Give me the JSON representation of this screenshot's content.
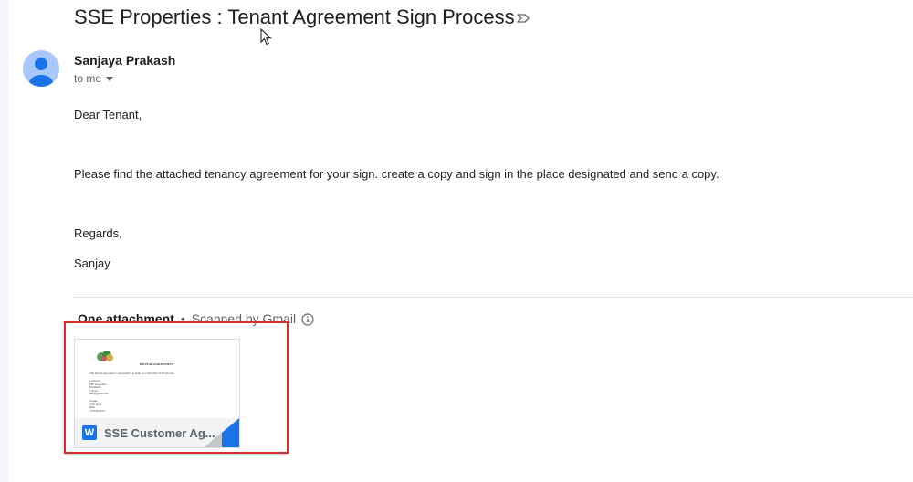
{
  "email": {
    "subject": "SSE Properties : Tenant Agreement Sign Process",
    "sender_name": "Sanjaya Prakash",
    "recipient_label": "to me",
    "body": {
      "greeting": "Dear Tenant,",
      "message": "Please find the attached tenancy agreement for your sign. create a copy and sign in the place designated and send a copy.",
      "closing": "Regards,",
      "signature": "Sanjay"
    }
  },
  "attachments": {
    "header_title": "One attachment",
    "separator": "•",
    "scanned_label": "Scanned by Gmail",
    "items": [
      {
        "file_name": "SSE Customer Ag...",
        "file_type_letter": "W",
        "icon": "word-doc-icon",
        "preview": {
          "heading": "RENTAL AGREEMENT",
          "lines": [
            "This Rental Agreement (\"Agreement\") is made on 14.09.2024 10:30 between",
            "Landlord:",
            "SSE properties",
            "Bristrunch",
            "Contact:",
            "info@gmail.com",
            "Tenant:",
            "Uma Jointt",
            "Hills",
            "+9734426574"
          ]
        }
      }
    ]
  },
  "colors": {
    "highlight": "#d32f2f",
    "avatar_bg": "#a8c7fa",
    "avatar_fg": "#1a73e8",
    "word_blue": "#1a73e8"
  }
}
